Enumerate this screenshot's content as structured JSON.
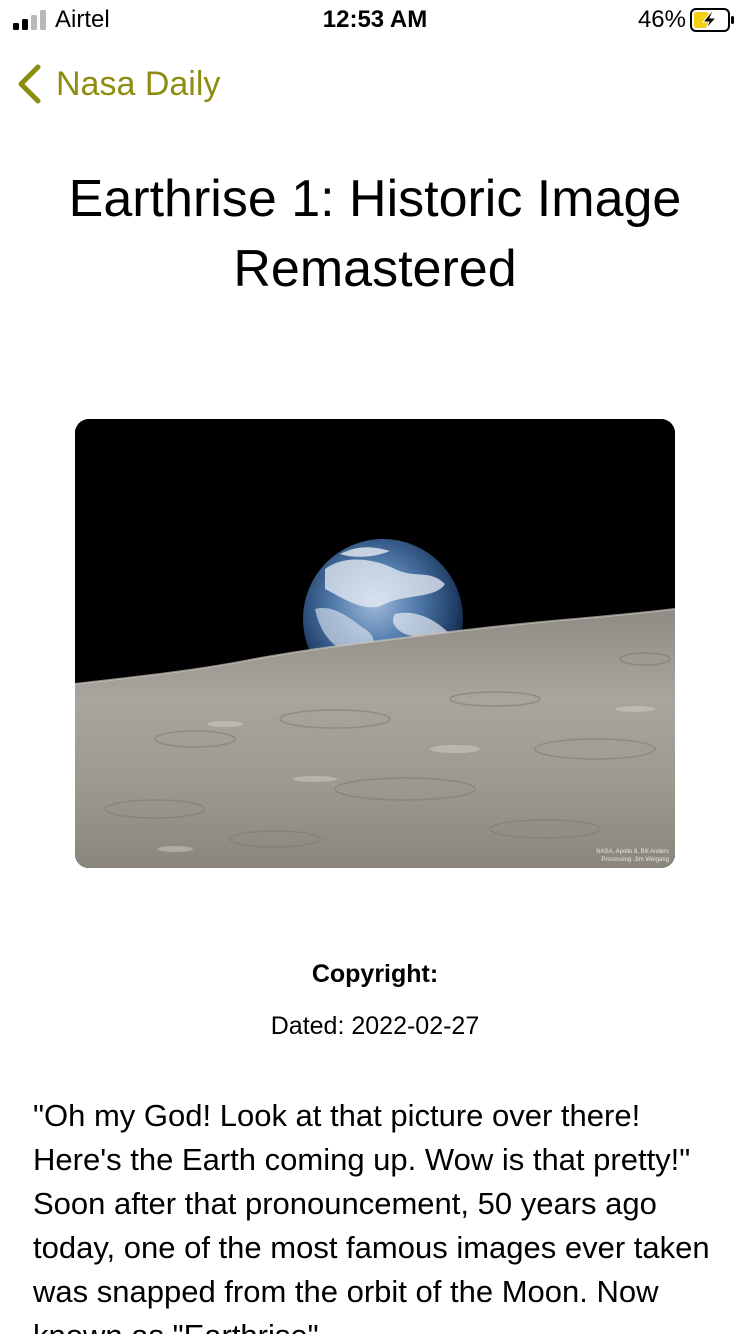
{
  "status_bar": {
    "carrier": "Airtel",
    "time": "12:53 AM",
    "battery_percent": "46%",
    "battery_level": 0.46,
    "charging": true
  },
  "nav": {
    "back_label": "Nasa Daily",
    "accent_color": "#8e8d12"
  },
  "article": {
    "title": "Earthrise 1: Historic Image Remastered",
    "image_credit_line1": "NASA, Apollo 8, Bill Anders",
    "image_credit_line2": "Processing: Jim Weigang",
    "copyright_label": "Copyright:",
    "dated": "Dated: 2022-02-27",
    "explanation": "\"Oh my God! Look at that picture over there! Here's the Earth coming up. Wow is that pretty!\" Soon after that pronouncement, 50 years ago today, one of the most famous images ever taken was snapped from the orbit of the Moon. Now known as \"Earthrise\""
  }
}
